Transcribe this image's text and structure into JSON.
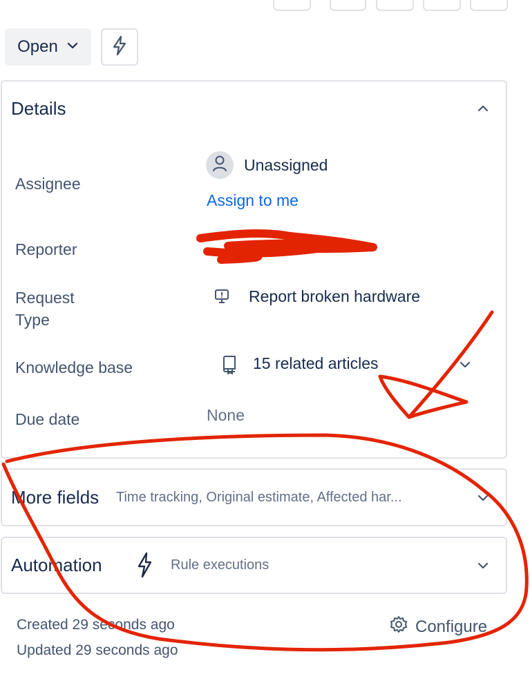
{
  "toolbar": {
    "status_label": "Open"
  },
  "details": {
    "title": "Details",
    "fields": {
      "assignee": {
        "label": "Assignee",
        "value": "Unassigned",
        "action": "Assign to me"
      },
      "reporter": {
        "label": "Reporter"
      },
      "request_type": {
        "label": "Request Type",
        "value": "Report broken hardware"
      },
      "knowledge_base": {
        "label": "Knowledge base",
        "value": "15 related articles"
      },
      "due_date": {
        "label": "Due date",
        "value": "None"
      }
    }
  },
  "more_fields": {
    "title": "More fields",
    "summary": "Time tracking, Original estimate, Affected har..."
  },
  "automation": {
    "title": "Automation",
    "subtitle": "Rule executions"
  },
  "footer": {
    "created": "Created 29 seconds ago",
    "updated": "Updated 29 seconds ago",
    "configure_label": "Configure"
  },
  "colors": {
    "text": "#172b4d",
    "label": "#44546f",
    "link": "#0c66e4",
    "border": "#dfe1e6",
    "annotation": "#e32400"
  }
}
